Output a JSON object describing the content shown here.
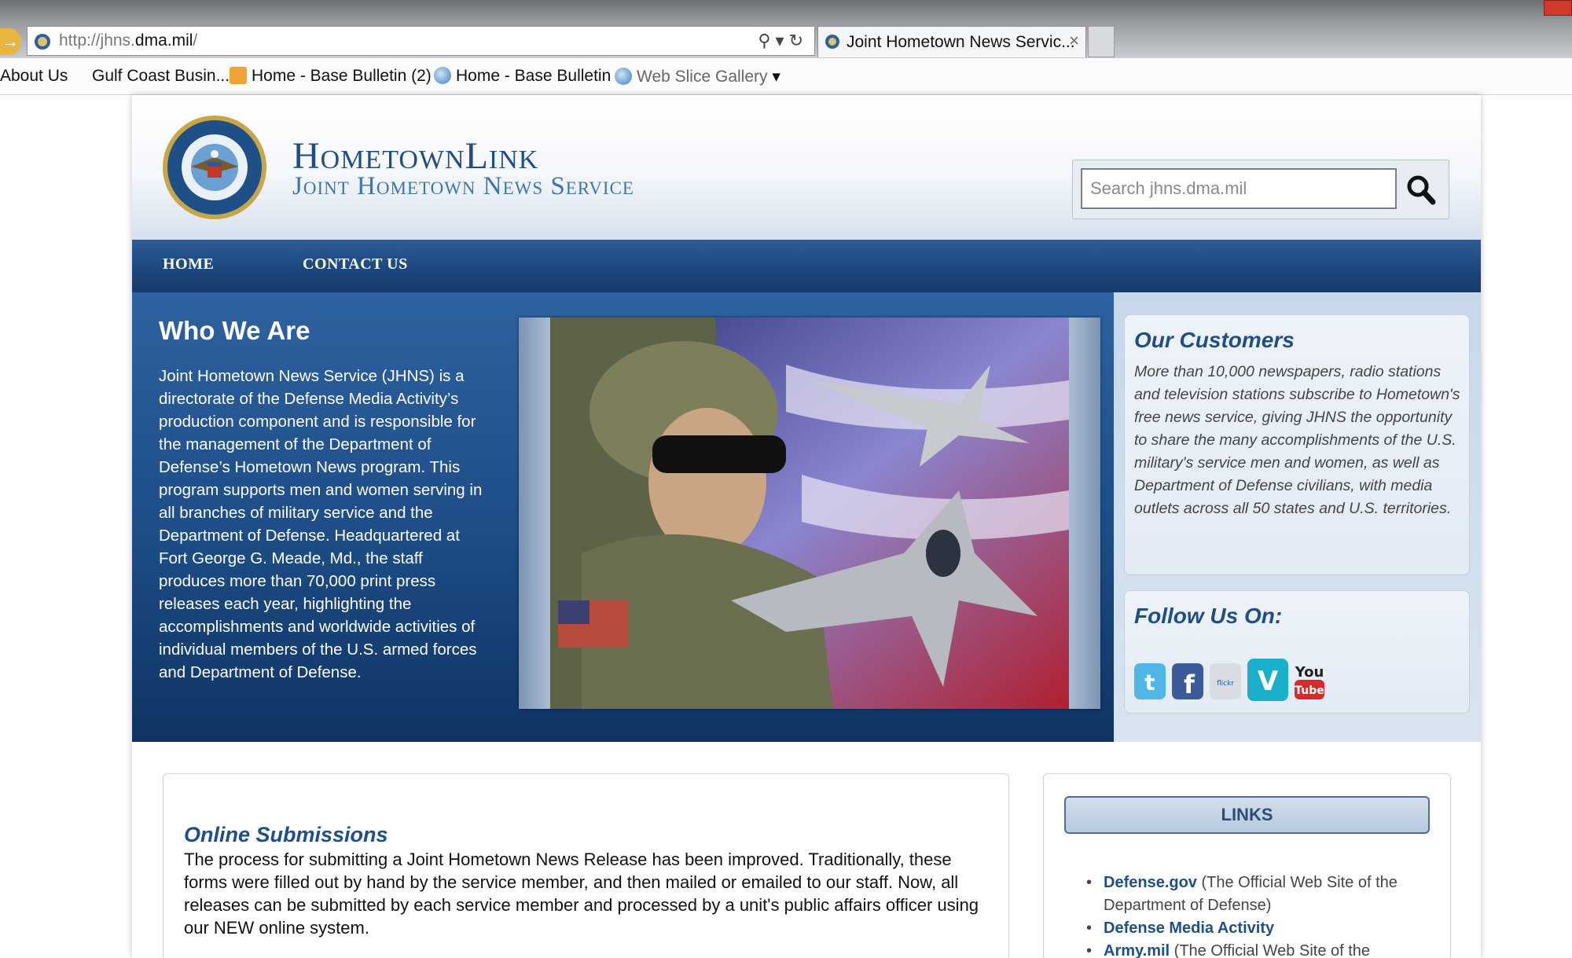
{
  "browser": {
    "url_prefix": "http://jhns.",
    "url_domain": "dma.mil",
    "url_suffix": "/",
    "tab_title": "Joint Hometown News Servic...",
    "tab_close": "×",
    "favorites": [
      {
        "label": "About Us",
        "icon": "page-icon"
      },
      {
        "label": "Gulf Coast Busin...",
        "icon": "none"
      },
      {
        "label": "Home - Base Bulletin (2)",
        "icon": "rss-feed-icon"
      },
      {
        "label": "Home - Base Bulletin",
        "icon": "ie-globe-icon"
      },
      {
        "label": "Web Slice Gallery",
        "icon": "ie-globe-icon"
      }
    ]
  },
  "header": {
    "brand_main": "HometownLink",
    "brand_sub": "Joint Hometown News Service",
    "search_placeholder": "Search jhns.dma.mil"
  },
  "nav": {
    "items": [
      "HOME",
      "CONTACT US"
    ]
  },
  "hero": {
    "title": "Who We Are",
    "text": "Joint Hometown News Service (JHNS) is a directorate of the Defense Media Activity’s production component and is responsible for the management of the Department of Defense’s Hometown News program. This program supports men and women serving in all branches of military service and the Department of Defense. Headquartered at Fort George G. Meade, Md., the staff produces more than 70,000 print press releases each year, highlighting the accomplishments and worldwide activities of individual members of the U.S. armed forces and Department of Defense."
  },
  "customers": {
    "title": "Our Customers",
    "text": "More than 10,000 newspapers, radio stations and television stations subscribe to Hometown's free news service, giving JHNS the opportunity to share the many accomplishments of the U.S. military's service men and women, as well as Department of Defense civilians, with media outlets across all 50 states and U.S. territories."
  },
  "follow": {
    "title": "Follow Us On:",
    "icons": [
      "twitter-icon",
      "facebook-icon",
      "flickr-icon",
      "vimeo-icon",
      "youtube-icon"
    ],
    "flickr_text": "flickr",
    "vimeo_text": "V",
    "youtube_text_1": "You",
    "youtube_text_2": "Tube"
  },
  "submissions": {
    "title": "Online Submissions",
    "text": "The process for submitting a Joint Hometown News Release has been improved. Traditionally, these forms were filled out by hand by the service member, and then mailed or emailed to our staff. Now, all releases can be submitted by each service member and processed by a unit's public affairs officer using our NEW online system."
  },
  "links": {
    "button": "LINKS",
    "items": [
      {
        "name": "Defense.gov",
        "desc": "(The Official Web Site of the Department of Defense)"
      },
      {
        "name": "Defense Media Activity",
        "desc": ""
      },
      {
        "name": "Army.mil",
        "desc": "(The Official Web Site of the"
      }
    ]
  },
  "colors": {
    "brand_dark": "#1f4e86",
    "nav_blue": "#1c467c",
    "hero_blue": "#1d4c86",
    "link_blue": "#1f4f87"
  }
}
